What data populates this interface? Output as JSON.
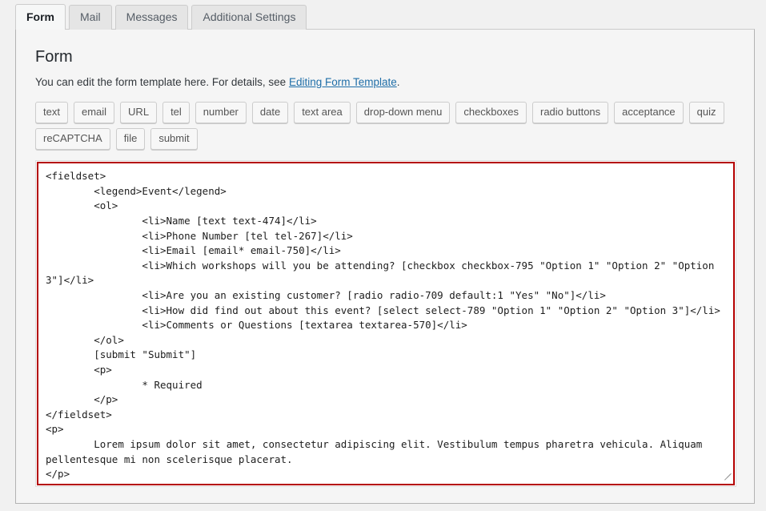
{
  "tabs": [
    {
      "label": "Form",
      "active": true
    },
    {
      "label": "Mail",
      "active": false
    },
    {
      "label": "Messages",
      "active": false
    },
    {
      "label": "Additional Settings",
      "active": false
    }
  ],
  "panel": {
    "title": "Form",
    "description_before": "You can edit the form template here. For details, see ",
    "description_link": "Editing Form Template",
    "description_after": "."
  },
  "tag_buttons": [
    "text",
    "email",
    "URL",
    "tel",
    "number",
    "date",
    "text area",
    "drop-down menu",
    "checkboxes",
    "radio buttons",
    "acceptance",
    "quiz",
    "reCAPTCHA",
    "file",
    "submit"
  ],
  "editor": {
    "validation_border_color": "#b40000",
    "value": "<fieldset>\n\t<legend>Event</legend>\n\t<ol>\n\t\t<li>Name [text text-474]</li>\n\t\t<li>Phone Number [tel tel-267]</li>\n\t\t<li>Email [email* email-750]</li>\n\t\t<li>Which workshops will you be attending? [checkbox checkbox-795 \"Option 1\" \"Option 2\" \"Option 3\"]</li>\n\t\t<li>Are you an existing customer? [radio radio-709 default:1 \"Yes\" \"No\"]</li>\n\t\t<li>How did find out about this event? [select select-789 \"Option 1\" \"Option 2\" \"Option 3\"]</li>\n\t\t<li>Comments or Questions [textarea textarea-570]</li>\n\t</ol>\n\t[submit \"Submit\"]\n\t<p>\n\t\t* Required\n\t</p>\n</fieldset>\n<p>\n\tLorem ipsum dolor sit amet, consectetur adipiscing elit. Vestibulum tempus pharetra vehicula. Aliquam pellentesque mi non scelerisque placerat.\n</p>"
  }
}
